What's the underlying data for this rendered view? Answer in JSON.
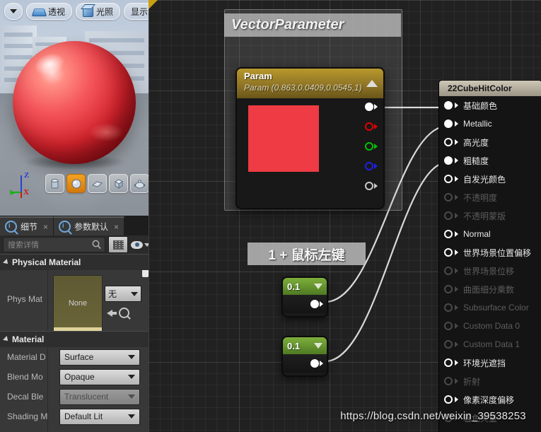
{
  "viewport": {
    "toolbar": [
      {
        "name": "view-options-button",
        "label": "",
        "icon": "caret-down-icon"
      },
      {
        "name": "perspective-button",
        "label": "透视",
        "icon": "perspective-icon"
      },
      {
        "name": "lighting-button",
        "label": "光照",
        "icon": "cube-icon"
      },
      {
        "name": "show-button",
        "label": "显示",
        "icon": ""
      }
    ],
    "shapes": [
      {
        "name": "cylinder-preview-button",
        "icon": "cylinder-icon",
        "selected": false
      },
      {
        "name": "sphere-preview-button",
        "icon": "sphere-icon",
        "selected": true
      },
      {
        "name": "plane-preview-button",
        "icon": "plane-icon",
        "selected": false
      },
      {
        "name": "cube-preview-button",
        "icon": "cube-icon",
        "selected": false
      },
      {
        "name": "teapot-preview-button",
        "icon": "teapot-icon",
        "selected": false
      }
    ],
    "gizmo": {
      "z": "Z",
      "x": "X",
      "y": ""
    }
  },
  "details": {
    "tabs": [
      {
        "label": "细节",
        "icon": "search-details-icon",
        "close": "×",
        "active": true
      },
      {
        "label": "参数默认",
        "icon": "search-params-icon",
        "close": "×",
        "active": false
      }
    ],
    "search": {
      "placeholder": "搜索详情",
      "value": "",
      "icon": "magnifier-icon"
    },
    "grid_button": "grid-view-icon",
    "eye_button": "eye-visibility-icon",
    "sections": [
      {
        "title": "Physical Material",
        "rows": [
          {
            "label": "Phys Mat",
            "type": "asset",
            "thumb_text": "None",
            "combo": "无",
            "icons": [
              "back-arrow-icon",
              "browse-icon"
            ]
          }
        ]
      },
      {
        "title": "Material",
        "rows": [
          {
            "label": "Material D",
            "type": "combo",
            "value": "Surface",
            "disabled": false
          },
          {
            "label": "Blend Mo",
            "type": "combo",
            "value": "Opaque",
            "disabled": false
          },
          {
            "label": "Decal Ble",
            "type": "combo",
            "value": "Translucent",
            "disabled": true
          },
          {
            "label": "Shading M",
            "type": "combo",
            "value": "Default Lit",
            "disabled": false
          }
        ]
      }
    ]
  },
  "graph": {
    "comment": {
      "title": "VectorParameter"
    },
    "tooltip": {
      "text": "1 + 鼠标左键"
    },
    "param_node": {
      "title": "Param",
      "subtitle": "Param (0.863,0.0409,0.0545,1)",
      "swatch_color": "#ee3b44",
      "collapse_icon": "triangle-up-icon",
      "pins": [
        {
          "name": "rgb-output-pin",
          "color": "#ffffff",
          "filled": true
        },
        {
          "name": "r-output-pin",
          "color": "#e00000",
          "filled": false
        },
        {
          "name": "g-output-pin",
          "color": "#00c000",
          "filled": false
        },
        {
          "name": "b-output-pin",
          "color": "#2020e8",
          "filled": false
        },
        {
          "name": "a-output-pin",
          "color": "#c8c8c8",
          "filled": false
        }
      ]
    },
    "scalar_nodes": [
      {
        "value": "0.1",
        "name": "scalar-node-1"
      },
      {
        "value": "0.1",
        "name": "scalar-node-2"
      }
    ],
    "material_node": {
      "title": "22CubeHitColor",
      "inputs": [
        {
          "label": "基础颜色",
          "connected": true,
          "enabled": true
        },
        {
          "label": "Metallic",
          "connected": true,
          "enabled": true
        },
        {
          "label": "高光度",
          "connected": false,
          "enabled": true
        },
        {
          "label": "粗糙度",
          "connected": true,
          "enabled": true
        },
        {
          "label": "自发光颜色",
          "connected": false,
          "enabled": true
        },
        {
          "label": "不透明度",
          "connected": false,
          "enabled": false
        },
        {
          "label": "不透明蒙版",
          "connected": false,
          "enabled": false
        },
        {
          "label": "Normal",
          "connected": false,
          "enabled": true
        },
        {
          "label": "世界场景位置偏移",
          "connected": false,
          "enabled": true
        },
        {
          "label": "世界场景位移",
          "connected": false,
          "enabled": false
        },
        {
          "label": "曲面细分乘数",
          "connected": false,
          "enabled": false
        },
        {
          "label": "Subsurface Color",
          "connected": false,
          "enabled": false
        },
        {
          "label": "Custom Data 0",
          "connected": false,
          "enabled": false
        },
        {
          "label": "Custom Data 1",
          "connected": false,
          "enabled": false
        },
        {
          "label": "环境光遮挡",
          "connected": false,
          "enabled": true
        },
        {
          "label": "折射",
          "connected": false,
          "enabled": false
        },
        {
          "label": "像素深度偏移",
          "connected": false,
          "enabled": true
        },
        {
          "label": "着色矢量",
          "connected": false,
          "enabled": false
        }
      ]
    }
  },
  "watermark": {
    "text": "https://blog.csdn.net/weixin_39538253"
  }
}
